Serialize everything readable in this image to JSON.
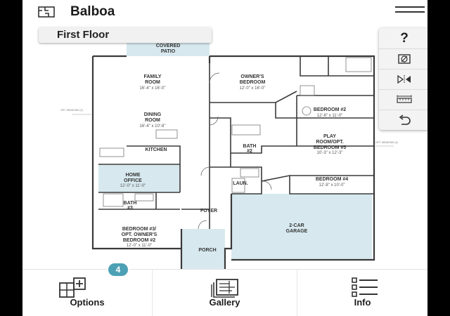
{
  "header": {
    "title": "Balboa",
    "home_icon": "floorplan-icon",
    "menu_icon": "hamburger-menu-icon"
  },
  "floor_selector": {
    "label": "First Floor"
  },
  "plan": {
    "rooms": [
      {
        "name": "COVERED",
        "name2": "PATIO",
        "dims": ""
      },
      {
        "name": "FAMILY",
        "name2": "ROOM",
        "dims": "16'-4\" x 16'-0\""
      },
      {
        "name": "OWNER'S",
        "name2": "BEDROOM",
        "dims": "12'-0\" x 16'-0\""
      },
      {
        "name": "DINING",
        "name2": "ROOM",
        "dims": "16'-4\" x 10'-8\""
      },
      {
        "name": "BEDROOM #2",
        "name2": "",
        "dims": "12'-6\" x 11'-0\""
      },
      {
        "name": "PLAY",
        "name2": "ROOM/OPT.",
        "name3": "BEDROOM #5",
        "dims": "10'-3\" x 12'-3\""
      },
      {
        "name": "KITCHEN",
        "name2": "",
        "dims": ""
      },
      {
        "name": "BATH",
        "name2": "#2",
        "dims": ""
      },
      {
        "name": "HOME",
        "name2": "OFFICE",
        "dims": "12'-0\" x 11'-0\""
      },
      {
        "name": "LAUN.",
        "name2": "",
        "dims": ""
      },
      {
        "name": "BEDROOM #4",
        "name2": "",
        "dims": "12'-8\" x 10'-0\""
      },
      {
        "name": "BATH",
        "name2": "#3",
        "dims": ""
      },
      {
        "name": "FOYER",
        "name2": "",
        "dims": ""
      },
      {
        "name": "2-CAR",
        "name2": "GARAGE",
        "dims": ""
      },
      {
        "name": "BEDROOM #3/",
        "name2": "OPT. OWNER'S",
        "name3": "BEDROOM #2",
        "dims": "12'-0\" x 11'-0\""
      },
      {
        "name": "PORCH",
        "name2": "",
        "dims": ""
      }
    ],
    "notes": {
      "windows_left": "OPT. WINDOWS (2)",
      "windows_right": "OPT. WINDOWS (2)"
    },
    "colors": {
      "highlight": "#d7e9ef",
      "walls": "#3a3a3a"
    }
  },
  "tools": [
    {
      "name": "help",
      "label": "?",
      "icon": "question-mark-icon"
    },
    {
      "name": "hide-furniture",
      "icon": "no-furniture-icon"
    },
    {
      "name": "mirror",
      "icon": "mirror-flip-icon"
    },
    {
      "name": "measure",
      "icon": "ruler-measure-icon"
    },
    {
      "name": "reset",
      "icon": "undo-icon"
    }
  ],
  "bottom_nav": [
    {
      "label": "Options",
      "icon": "plan-options-icon",
      "badge": "4"
    },
    {
      "label": "Gallery",
      "icon": "gallery-icon"
    },
    {
      "label": "Info",
      "icon": "list-info-icon"
    }
  ],
  "colors": {
    "accent": "#4da1b5",
    "header_text": "#1c1c1c"
  }
}
